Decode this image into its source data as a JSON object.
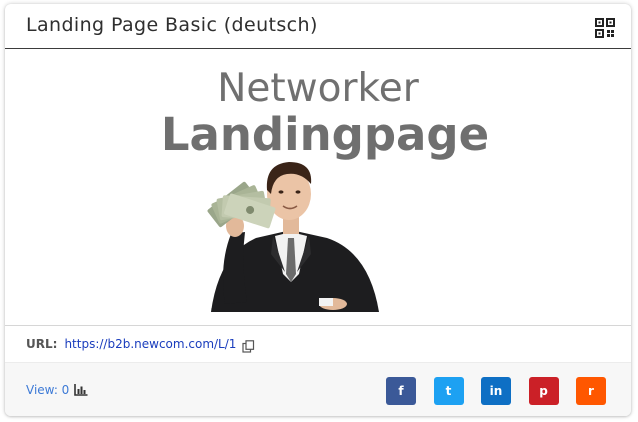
{
  "card": {
    "title": "Landing Page Basic (deutsch)",
    "qr_icon": "qr-code-icon"
  },
  "hero": {
    "line1": "Networker",
    "line2": "Landingpage",
    "image": "businessman-holding-money-photo"
  },
  "url": {
    "label": "URL:",
    "link": "https://b2b.newcom.com/L/1",
    "copy_icon": "copy-icon"
  },
  "views": {
    "label": "View: 0",
    "icon": "chart-icon"
  },
  "share": {
    "buttons": [
      {
        "network": "facebook",
        "glyph": "f",
        "color": "#3b5998"
      },
      {
        "network": "twitter",
        "glyph": "t",
        "color": "#1da1f2"
      },
      {
        "network": "linkedin",
        "glyph": "in",
        "color": "#0e6fc4"
      },
      {
        "network": "pinterest",
        "glyph": "p",
        "color": "#cb2027"
      },
      {
        "network": "reddit",
        "glyph": "r",
        "color": "#ff5700"
      }
    ]
  },
  "colors": {
    "header_rule": "#3b3b3b",
    "link": "#1a3dbd",
    "views_text": "#3d7ad6",
    "footer_bg": "#f7f7f7"
  }
}
